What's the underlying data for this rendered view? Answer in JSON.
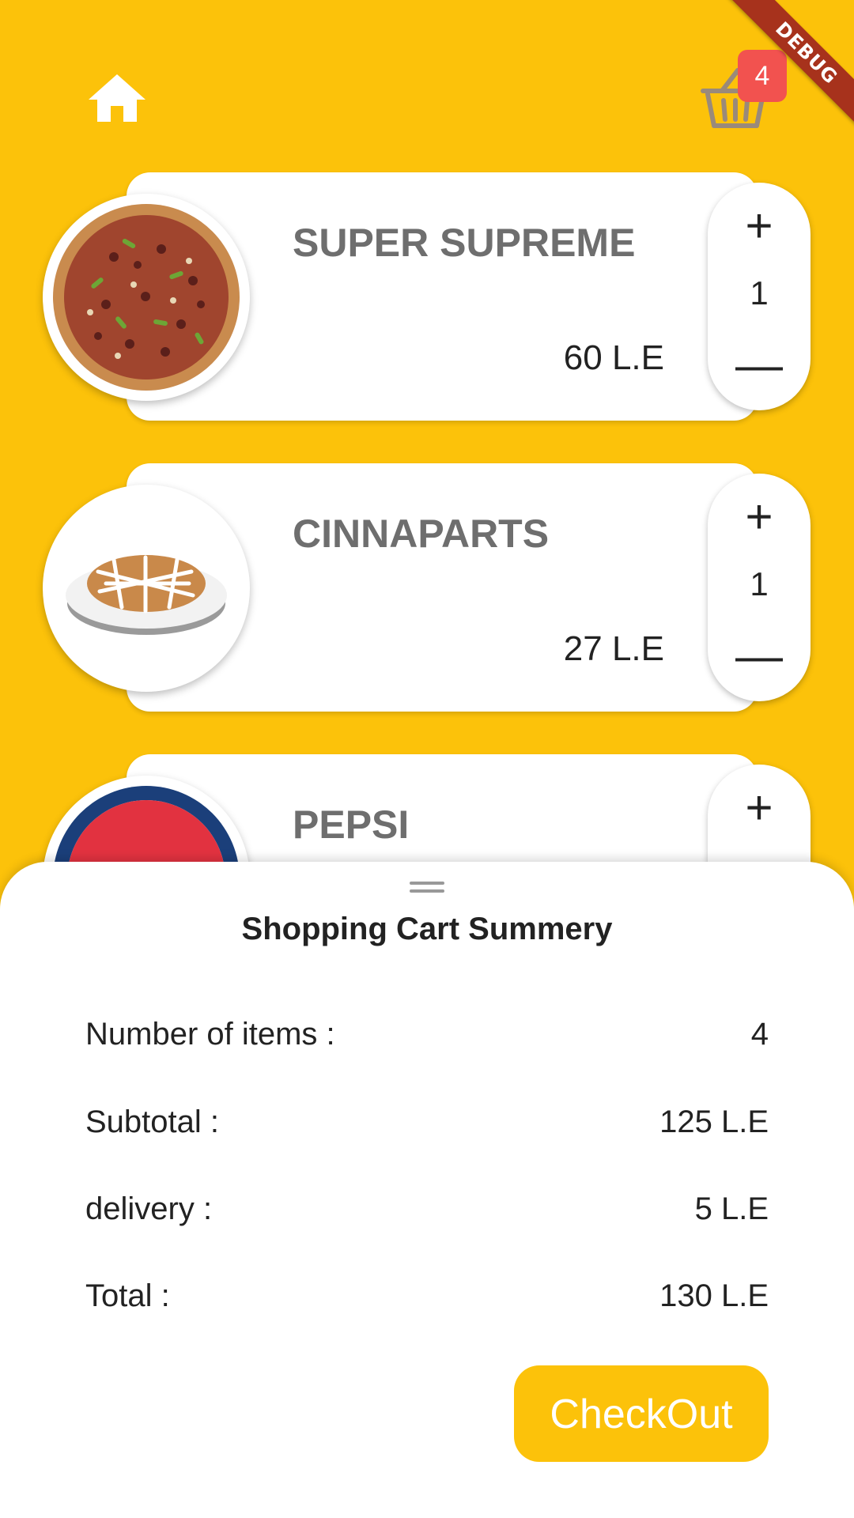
{
  "header": {
    "home_icon": "home-icon",
    "cart_icon": "basket-icon",
    "cart_badge_count": "4",
    "debug_label": "DEBUG"
  },
  "products": [
    {
      "name": "SUPER SUPREME",
      "price": "60 L.E",
      "quantity": "1",
      "image": "pizza"
    },
    {
      "name": "CINNAPARTS",
      "price": "27 L.E",
      "quantity": "1",
      "image": "cinnaparts-plate"
    },
    {
      "name": "PEPSI",
      "image": "pepsi-logo"
    }
  ],
  "stepper": {
    "plus": "+",
    "minus": "—"
  },
  "summary": {
    "title": "Shopping Cart Summery",
    "rows": [
      {
        "label": "Number of items :",
        "value": "4"
      },
      {
        "label": "Subtotal :",
        "value": "125 L.E"
      },
      {
        "label": "delivery :",
        "value": "5 L.E"
      },
      {
        "label": "Total :",
        "value": "130 L.E"
      }
    ],
    "checkout_label": "CheckOut"
  },
  "colors": {
    "background": "#FCC20A",
    "card": "#FFFFFF",
    "badge": "#F2524F",
    "debug_ribbon": "#A7321C",
    "product_name": "#6E6E6E"
  }
}
